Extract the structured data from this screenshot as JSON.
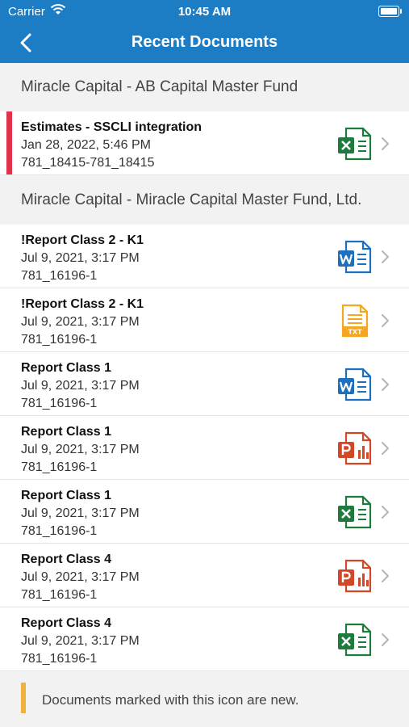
{
  "status_bar": {
    "carrier": "Carrier",
    "time": "10:45 AM"
  },
  "nav": {
    "title": "Recent Documents",
    "back_icon": "chevron-left-icon"
  },
  "sections": [
    {
      "header": "Miracle Capital - AB Capital Master Fund",
      "items": [
        {
          "name": "Estimates - SSCLI integration",
          "date": "Jan 28, 2022, 5:46 PM",
          "id": "781_18415-781_18415",
          "type": "excel",
          "new": true
        }
      ]
    },
    {
      "header": "Miracle Capital - Miracle Capital Master Fund, Ltd.",
      "items": [
        {
          "name": "!Report Class 2 - K1",
          "date": "Jul 9, 2021, 3:17 PM",
          "id": "781_16196-1",
          "type": "word",
          "new": false
        },
        {
          "name": "!Report Class 2 - K1",
          "date": "Jul 9, 2021, 3:17 PM",
          "id": "781_16196-1",
          "type": "txt",
          "new": false
        },
        {
          "name": "Report Class 1",
          "date": "Jul 9, 2021, 3:17 PM",
          "id": "781_16196-1",
          "type": "word",
          "new": false
        },
        {
          "name": "Report Class 1",
          "date": "Jul 9, 2021, 3:17 PM",
          "id": "781_16196-1",
          "type": "powerpoint",
          "new": false
        },
        {
          "name": "Report Class 1",
          "date": "Jul 9, 2021, 3:17 PM",
          "id": "781_16196-1",
          "type": "excel",
          "new": false
        },
        {
          "name": "Report Class 4",
          "date": "Jul 9, 2021, 3:17 PM",
          "id": "781_16196-1",
          "type": "powerpoint",
          "new": false
        },
        {
          "name": "Report Class 4",
          "date": "Jul 9, 2021, 3:17 PM",
          "id": "781_16196-1",
          "type": "excel",
          "new": false
        }
      ]
    }
  ],
  "legend": {
    "text": "Documents marked with this icon are new."
  },
  "colors": {
    "header_blue": "#1d7dc4",
    "new_marker": "#e0324b",
    "legend_marker": "#f0b13f",
    "excel": "#1f7a3e",
    "word": "#1f6fbf",
    "txt": "#f5a623",
    "powerpoint": "#d24726"
  }
}
